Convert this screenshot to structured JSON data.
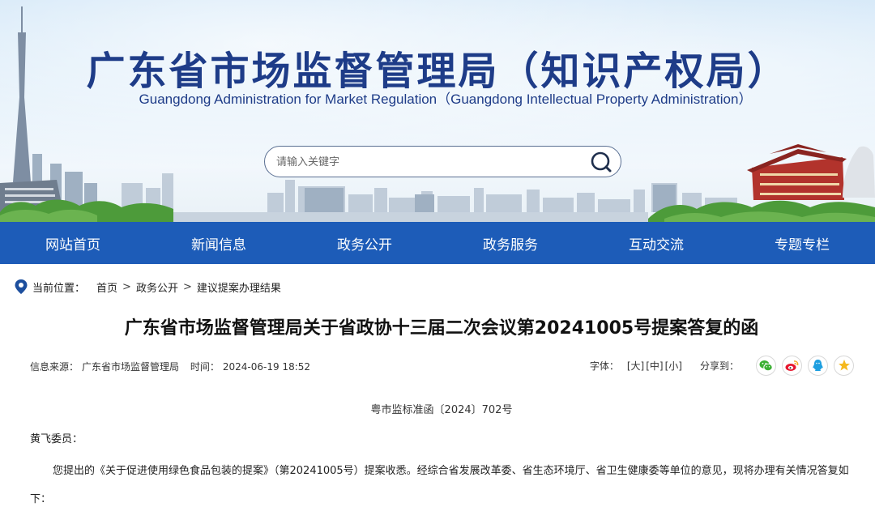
{
  "header": {
    "title_cn": "广东省市场监督管理局（知识产权局）",
    "title_en": "Guangdong Administration for Market Regulation（Guangdong Intellectual Property Administration）"
  },
  "search": {
    "placeholder": "请输入关键字",
    "icon": "search-icon"
  },
  "nav": {
    "items": [
      {
        "label": "网站首页"
      },
      {
        "label": "新闻信息"
      },
      {
        "label": "政务公开"
      },
      {
        "label": "政务服务"
      },
      {
        "label": "互动交流"
      },
      {
        "label": "专题专栏"
      }
    ]
  },
  "breadcrumb": {
    "prefix": "当前位置：",
    "items": [
      "首页",
      "政务公开",
      "建议提案办理结果"
    ],
    "separator": ">"
  },
  "article": {
    "title": "广东省市场监督管理局关于省政协十三届二次会议第20241005号提案答复的函",
    "source_label": "信息来源：",
    "source": "广东省市场监督管理局",
    "time_label": "时间：",
    "time": "2024-06-19 18:52",
    "font_label": "字体：",
    "font_large": "[大]",
    "font_medium": "[中]",
    "font_small": "[小]",
    "share_label": "分享到：",
    "doc_number": "粤市监标准函〔2024〕702号",
    "salutation": "黄飞委员：",
    "body": "您提出的《关于促进使用绿色食品包装的提案》（第20241005号）提案收悉。经综合省发展改革委、省生态环境厅、省卫生健康委等单位的意见，现将办理有关情况答复如下："
  },
  "share_icons": [
    "wechat-icon",
    "weibo-icon",
    "qq-icon",
    "qzone-icon"
  ],
  "colors": {
    "brand_blue": "#1d5cb8",
    "title_blue": "#1e3c88",
    "wechat": "#3cb034",
    "weibo": "#e6162d",
    "qq": "#1e9fe0",
    "qzone": "#f5b81d"
  }
}
